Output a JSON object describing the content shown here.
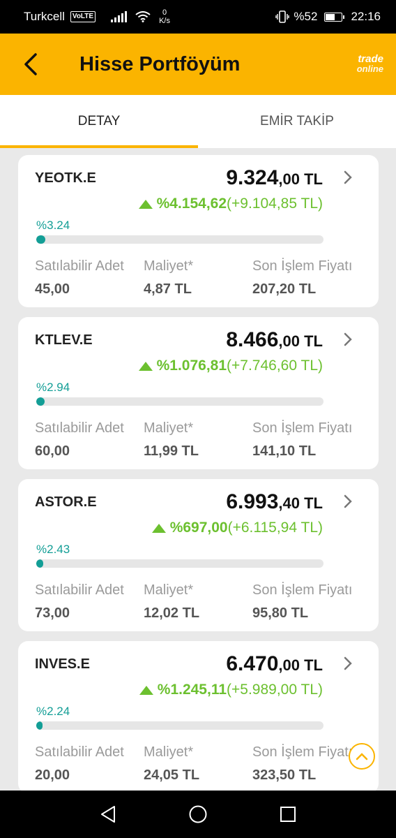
{
  "status_bar": {
    "carrier": "Turkcell",
    "volte": "VoLTE",
    "net_speed_value": "0",
    "net_speed_unit": "K/s",
    "battery": "%52",
    "battery_level": 0.52,
    "time": "22:16"
  },
  "header": {
    "title": "Hisse Portföyüm",
    "brand_line1": "trade",
    "brand_line2": "online"
  },
  "tabs": [
    {
      "label": "DETAY",
      "active": true
    },
    {
      "label": "EMİR TAKİP",
      "active": false
    }
  ],
  "columns": {
    "qty": "Satılabilir Adet",
    "cost": "Maliyet*",
    "last": "Son İşlem Fiyatı"
  },
  "stocks": [
    {
      "symbol": "YEOTK.E",
      "value_main": "9.324",
      "value_dec": ",00 TL",
      "change_pct": "%4.154,62",
      "change_amt": "(+9.104,85 TL)",
      "share_label": "%3.24",
      "share": 3.24,
      "qty": "45,00",
      "cost": "4,87 TL",
      "last": "207,20 TL"
    },
    {
      "symbol": "KTLEV.E",
      "value_main": "8.466",
      "value_dec": ",00 TL",
      "change_pct": "%1.076,81",
      "change_amt": "(+7.746,60 TL)",
      "share_label": "%2.94",
      "share": 2.94,
      "qty": "60,00",
      "cost": "11,99 TL",
      "last": "141,10 TL"
    },
    {
      "symbol": "ASTOR.E",
      "value_main": "6.993",
      "value_dec": ",40 TL",
      "change_pct": "%697,00",
      "change_amt": "(+6.115,94 TL)",
      "share_label": "%2.43",
      "share": 2.43,
      "qty": "73,00",
      "cost": "12,02 TL",
      "last": "95,80 TL"
    },
    {
      "symbol": "INVES.E",
      "value_main": "6.470",
      "value_dec": ",00 TL",
      "change_pct": "%1.245,11",
      "change_amt": "(+5.989,00 TL)",
      "share_label": "%2.24",
      "share": 2.24,
      "qty": "20,00",
      "cost": "24,05 TL",
      "last": "323,50 TL"
    }
  ],
  "colors": {
    "accent": "#fbb400",
    "positive": "#6cc02f",
    "bar": "#139e96"
  },
  "icons": {
    "back": "arrow-left-icon",
    "chevron": "chevron-right-icon",
    "up": "triangle-up-icon",
    "scroll_top": "chevron-up-icon",
    "nav_back": "nav-back-icon",
    "nav_home": "nav-home-icon",
    "nav_recents": "nav-recents-icon"
  }
}
